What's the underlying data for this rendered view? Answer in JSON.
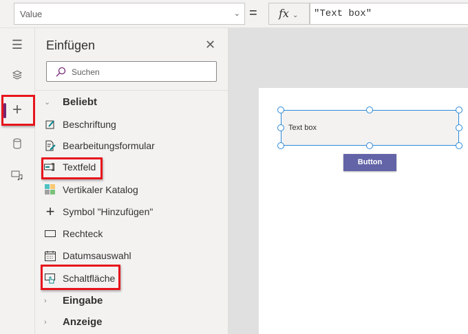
{
  "formula_bar": {
    "property": "Value",
    "equals": "=",
    "fx_label": "fx",
    "formula": "\"Text box\""
  },
  "rail": {
    "items": [
      "menu-icon",
      "layers-icon",
      "insert-icon",
      "data-icon",
      "media-icon"
    ]
  },
  "panel": {
    "title": "Einfügen",
    "search_placeholder": "Suchen",
    "sections": [
      {
        "label": "Beliebt",
        "expanded": true
      },
      {
        "label": "Eingabe",
        "expanded": false
      },
      {
        "label": "Anzeige",
        "expanded": false
      }
    ],
    "items": [
      "Beschriftung",
      "Bearbeitungsformular",
      "Textfeld",
      "Vertikaler Katalog",
      "Symbol \"Hinzufügen\"",
      "Rechteck",
      "Datumsauswahl",
      "Schaltfläche"
    ]
  },
  "canvas": {
    "textbox_text": "Text box",
    "button_label": "Button"
  },
  "colors": {
    "accent": "#742774",
    "button": "#6264a7",
    "selection": "#2b88d8",
    "highlight": "#e8141b"
  }
}
